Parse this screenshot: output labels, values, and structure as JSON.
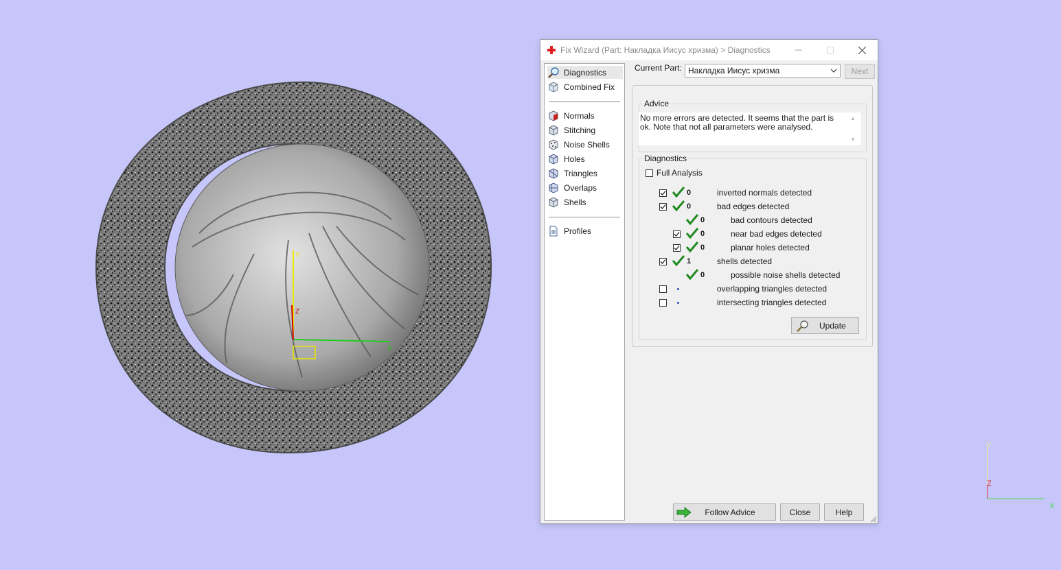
{
  "window": {
    "title": "Fix Wizard (Part: Накладка Иисус хризма) > Diagnostics"
  },
  "nav": {
    "items": [
      {
        "label": "Diagnostics",
        "icon": "magnifier-icon"
      },
      {
        "label": "Combined Fix",
        "icon": "cube-icon"
      },
      {
        "label": "Normals",
        "icon": "normals-cube-icon"
      },
      {
        "label": "Stitching",
        "icon": "stitching-cube-icon"
      },
      {
        "label": "Noise Shells",
        "icon": "noise-shells-icon"
      },
      {
        "label": "Holes",
        "icon": "holes-cube-icon"
      },
      {
        "label": "Triangles",
        "icon": "triangles-cube-icon"
      },
      {
        "label": "Overlaps",
        "icon": "overlaps-cube-icon"
      },
      {
        "label": "Shells",
        "icon": "shells-cube-icon"
      },
      {
        "label": "Profiles",
        "icon": "document-icon"
      }
    ]
  },
  "current_part": {
    "label": "Current Part:",
    "value": "Накладка Иисус хризма",
    "next_label": "Next"
  },
  "advice": {
    "legend": "Advice",
    "text": "No more errors are detected. It seems that the part is ok. Note that not all parameters were analysed."
  },
  "diagnostics": {
    "legend": "Diagnostics",
    "full_analysis_label": "Full Analysis",
    "full_analysis_checked": false,
    "rows": [
      {
        "checkbox": true,
        "checked": true,
        "status": "ok",
        "count": "0",
        "label": "inverted normals detected",
        "indent": 0
      },
      {
        "checkbox": true,
        "checked": true,
        "status": "ok",
        "count": "0",
        "label": "bad edges detected",
        "indent": 0
      },
      {
        "checkbox": false,
        "checked": false,
        "status": "ok",
        "count": "0",
        "label": "bad contours detected",
        "indent": 1
      },
      {
        "checkbox": true,
        "checked": true,
        "status": "ok",
        "count": "0",
        "label": "near bad edges detected",
        "indent": 1
      },
      {
        "checkbox": true,
        "checked": true,
        "status": "ok",
        "count": "0",
        "label": "planar holes detected",
        "indent": 1
      },
      {
        "checkbox": true,
        "checked": true,
        "status": "ok",
        "count": "1",
        "label": "shells detected",
        "indent": 0
      },
      {
        "checkbox": false,
        "checked": false,
        "status": "ok",
        "count": "0",
        "label": "possible noise shells detected",
        "indent": 1
      },
      {
        "checkbox": true,
        "checked": false,
        "status": "pending",
        "count": "",
        "label": "overlapping triangles detected",
        "indent": 0
      },
      {
        "checkbox": true,
        "checked": false,
        "status": "pending",
        "count": "",
        "label": "intersecting triangles detected",
        "indent": 0
      }
    ],
    "update_label": "Update"
  },
  "footer": {
    "follow_advice_label": "Follow Advice",
    "close_label": "Close",
    "help_label": "Help"
  },
  "viewport": {
    "background": "#c6c6fa",
    "corner_axes": {
      "y": "Y",
      "z": "Z",
      "x": "X"
    },
    "model_axes": {
      "y": "Y",
      "z": "Z",
      "x": "X"
    }
  }
}
